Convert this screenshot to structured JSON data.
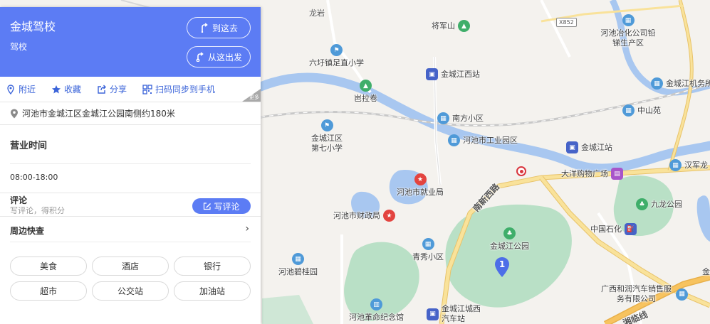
{
  "place": {
    "name": "金城驾校",
    "category": "驾校",
    "btn_to_here": "到这去",
    "btn_from_here": "从这出发",
    "corner_tag": "更多"
  },
  "actions": {
    "nearby": "附近",
    "favorite": "收藏",
    "share": "分享",
    "scan": "扫码同步到手机"
  },
  "address": "河池市金城江区金城江公园南侧约180米",
  "hours": {
    "title": "营业时间",
    "value": "08:00-18:00"
  },
  "review": {
    "title": "评论",
    "subtitle": "写评论，得积分",
    "button": "写评论"
  },
  "nearby": {
    "title": "周边快查",
    "chips": [
      "美食",
      "酒店",
      "银行",
      "超市",
      "公交站",
      "加油站"
    ]
  },
  "map": {
    "pin_number": "1",
    "shield": "X852",
    "roads": [
      "南新西路",
      "湘临线"
    ],
    "areas": [
      "龙岩"
    ],
    "pois": [
      "六圩镇足直小学",
      "将军山",
      "河池冶化公司铅锑生产区",
      "金城江西站",
      "金城江机务所",
      "岜拉卷",
      "南方小区",
      "中山苑",
      "金城江区第七小学",
      "河池市工业园区",
      "金城江站",
      "汉军龙",
      "大洋购物广场",
      "河池市就业局",
      "九龙公园",
      "河池市财政局",
      "中国石化",
      "金城江公园",
      "青秀小区",
      "河池碧桂园",
      "广西和润汽车销售服务有限公司",
      "河池革命纪念馆",
      "金城江城西汽车站",
      "金"
    ]
  },
  "colors": {
    "accent": "#5c7cf4",
    "link": "#3b64d9",
    "water": "#a8c7f0",
    "park": "#b9e0c6",
    "road_major": "#f7d77e"
  }
}
